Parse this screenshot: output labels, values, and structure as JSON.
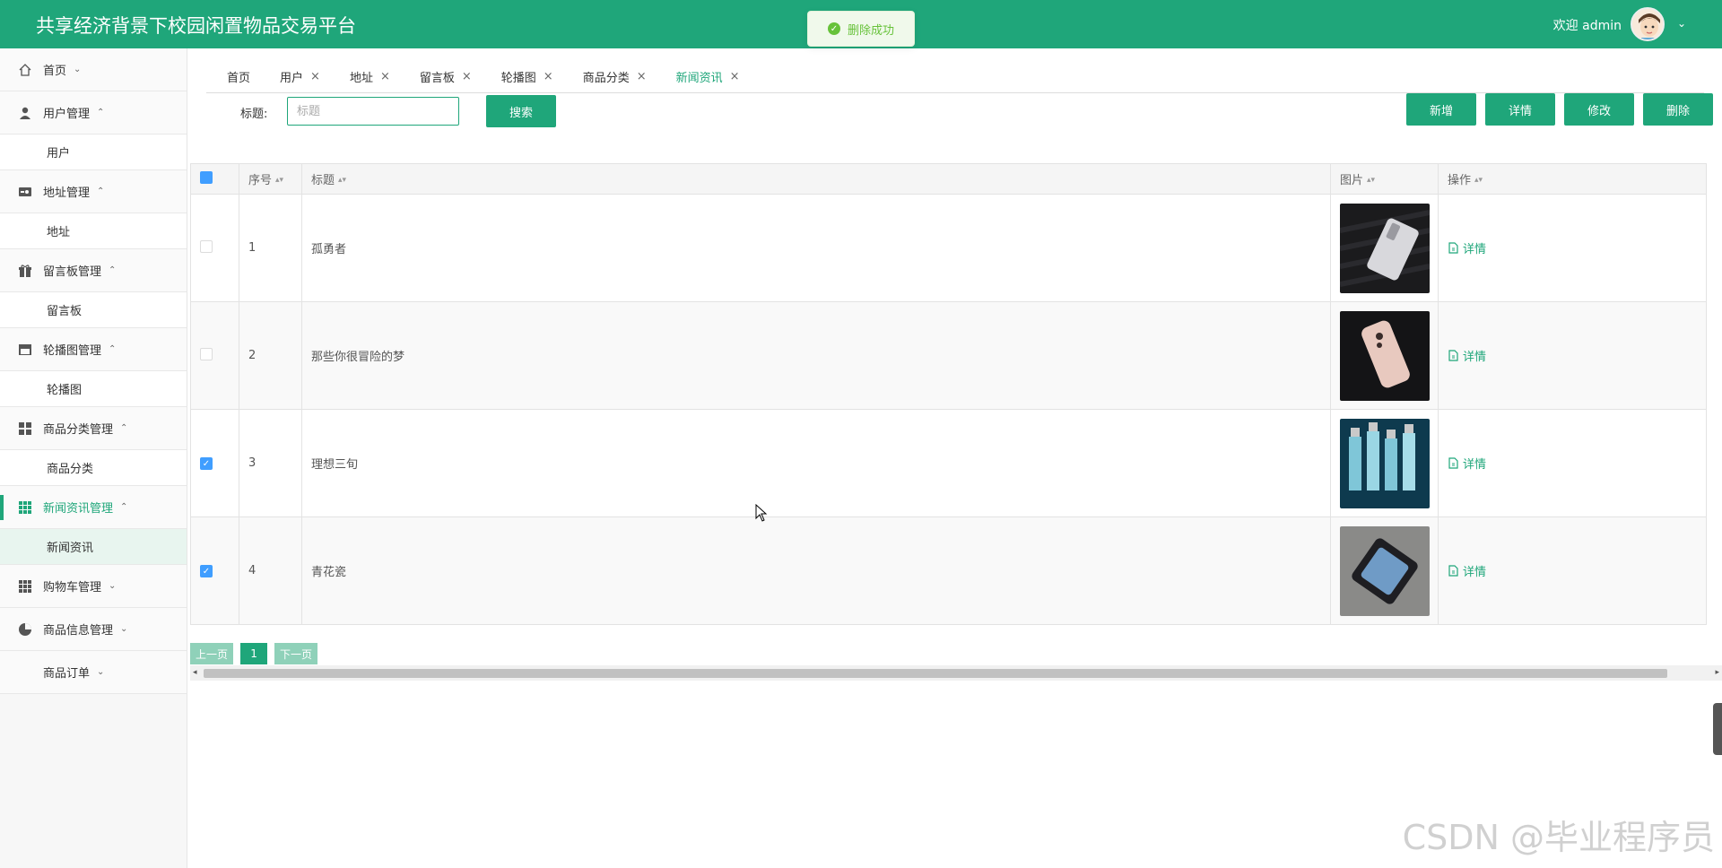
{
  "header": {
    "app_title": "共享经济背景下校园闲置物品交易平台",
    "welcome": "欢迎 admin"
  },
  "toast": {
    "message": "删除成功"
  },
  "sidebar": {
    "items": [
      {
        "label": "首页",
        "icon": "home-icon",
        "caret": "down"
      },
      {
        "label": "用户管理",
        "icon": "user-icon",
        "caret": "up",
        "sub": "用户"
      },
      {
        "label": "地址管理",
        "icon": "address-icon",
        "caret": "up",
        "sub": "地址"
      },
      {
        "label": "留言板管理",
        "icon": "gift-icon",
        "caret": "up",
        "sub": "留言板"
      },
      {
        "label": "轮播图管理",
        "icon": "shop-icon",
        "caret": "up",
        "sub": "轮播图"
      },
      {
        "label": "商品分类管理",
        "icon": "grid-icon",
        "caret": "up",
        "sub": "商品分类"
      },
      {
        "label": "新闻资讯管理",
        "icon": "apps-icon",
        "caret": "up",
        "sub": "新闻资讯"
      },
      {
        "label": "购物车管理",
        "icon": "apps-icon",
        "caret": "down"
      },
      {
        "label": "商品信息管理",
        "icon": "pie-icon",
        "caret": "down"
      },
      {
        "label": "商品订单",
        "icon": "",
        "caret": "down"
      }
    ]
  },
  "tabs": [
    {
      "label": "首页",
      "closable": false
    },
    {
      "label": "用户",
      "closable": true
    },
    {
      "label": "地址",
      "closable": true
    },
    {
      "label": "留言板",
      "closable": true
    },
    {
      "label": "轮播图",
      "closable": true
    },
    {
      "label": "商品分类",
      "closable": true
    },
    {
      "label": "新闻资讯",
      "closable": true,
      "active": true
    }
  ],
  "search": {
    "label": "标题:",
    "placeholder": "标题",
    "button": "搜索"
  },
  "actions": {
    "add": "新增",
    "detail": "详情",
    "edit": "修改",
    "delete": "删除"
  },
  "table": {
    "columns": [
      "序号",
      "标题",
      "图片",
      "操作"
    ],
    "rows": [
      {
        "index": "1",
        "title": "孤勇者",
        "checked": false,
        "detail": "详情"
      },
      {
        "index": "2",
        "title": "那些你很冒险的梦",
        "checked": false,
        "detail": "详情"
      },
      {
        "index": "3",
        "title": "理想三旬",
        "checked": true,
        "detail": "详情"
      },
      {
        "index": "4",
        "title": "青花瓷",
        "checked": true,
        "detail": "详情"
      }
    ]
  },
  "pager": {
    "prev": "上一页",
    "current": "1",
    "next": "下一页"
  },
  "watermark": "CSDN @毕业程序员",
  "colors": {
    "primary": "#1fa67a",
    "checkbox": "#409eff",
    "success": "#67c23a"
  }
}
